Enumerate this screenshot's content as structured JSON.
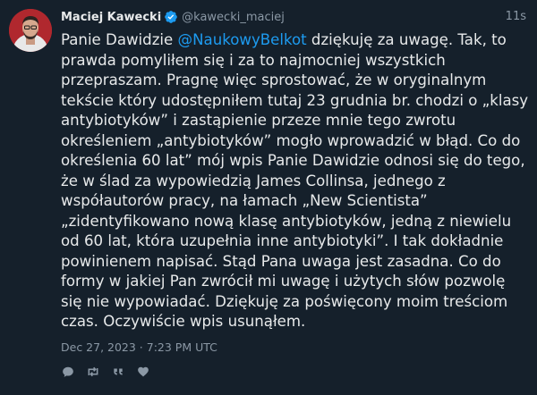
{
  "tweet": {
    "author_name": "Maciej Kawecki",
    "author_handle": "@kawecki_maciej",
    "relative_time": "11s",
    "body_lines": [
      {
        "pre": "Panie Dawidzie ",
        "mention": "@NaukowyBelkot",
        "post": " dziękuję za uwagę. Tak, to"
      },
      {
        "text": "prawda pomyliłem się i za to najmocniej wszystkich"
      },
      {
        "text": "przepraszam. Pragnę więc sprostować, że w oryginalnym"
      },
      {
        "text": "tekście który udostępniłem tutaj 23 grudnia br. chodzi o „klasy"
      },
      {
        "text": "antybiotyków” i zastąpienie przeze mnie tego zwrotu"
      },
      {
        "text": "określeniem „antybiotyków” mogło wprowadzić w błąd. Co do"
      },
      {
        "text": "określenia 60 lat” mój wpis Panie Dawidzie odnosi się do tego,"
      },
      {
        "text": "że w ślad za wypowiedzią James Collinsa, jednego z"
      },
      {
        "text": "współautorów pracy, na łamach „New Scientista”"
      },
      {
        "text": "„zidentyfikowano nową klasę antybiotyków, jedną z niewielu"
      },
      {
        "text": "od 60 lat, która uzupełnia inne antybiotyki”. I tak dokładnie"
      },
      {
        "text": "powinienem napisać. Stąd Pana uwaga jest zasadna. Co do"
      },
      {
        "text": "formy w jakiej Pan zwrócił mi uwagę i użytych słów pozwolę"
      },
      {
        "text": "się nie wypowiadać. Dziękuję za poświęcony moim treściom"
      },
      {
        "text": "czas. Oczywiście wpis usunąłem."
      }
    ],
    "timestamp": "Dec 27, 2023 · 7:23 PM UTC",
    "actions": [
      "reply-icon",
      "retweet-icon",
      "quote-icon",
      "like-icon"
    ]
  },
  "colors": {
    "background": "#15202b",
    "text": "#e7e9ea",
    "muted": "#8b98a5",
    "link": "#1d9bf0",
    "verified": "#1d9bf0"
  }
}
